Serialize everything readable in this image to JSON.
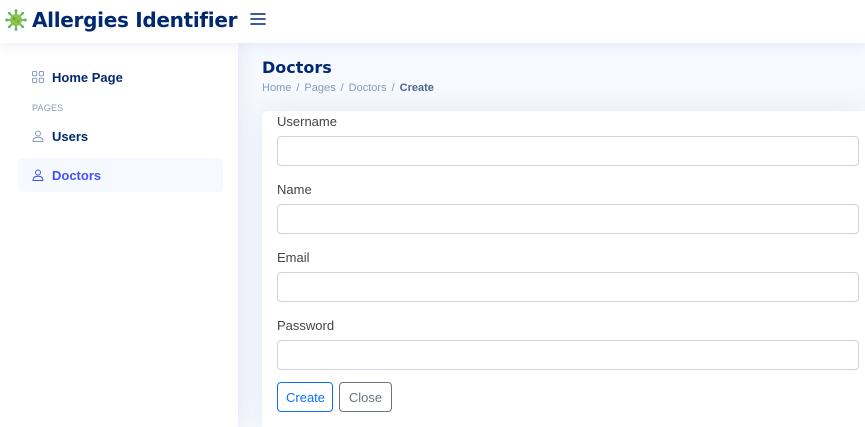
{
  "header": {
    "app_title": "Allergies Identifier",
    "logo_icon": "virus-icon",
    "menu_icon": "hamburger-menu-icon"
  },
  "sidebar": {
    "home": {
      "label": "Home Page",
      "icon": "grid-icon"
    },
    "heading": "PAGES",
    "items": [
      {
        "label": "Users",
        "icon": "person-icon",
        "active": false
      },
      {
        "label": "Doctors",
        "icon": "person-icon",
        "active": true
      }
    ]
  },
  "page": {
    "title": "Doctors",
    "breadcrumb": [
      "Home",
      "Pages",
      "Doctors",
      "Create"
    ]
  },
  "form": {
    "fields": [
      {
        "label": "Username",
        "value": ""
      },
      {
        "label": "Name",
        "value": ""
      },
      {
        "label": "Email",
        "value": ""
      },
      {
        "label": "Password",
        "value": ""
      }
    ],
    "create_label": "Create",
    "close_label": "Close"
  },
  "colors": {
    "brand_navy": "#012970",
    "active_blue": "#4154f1",
    "primary": "#0d6efd",
    "secondary": "#6c757d",
    "logo_green": "#4caf50",
    "page_bg": "#f6f9ff"
  }
}
